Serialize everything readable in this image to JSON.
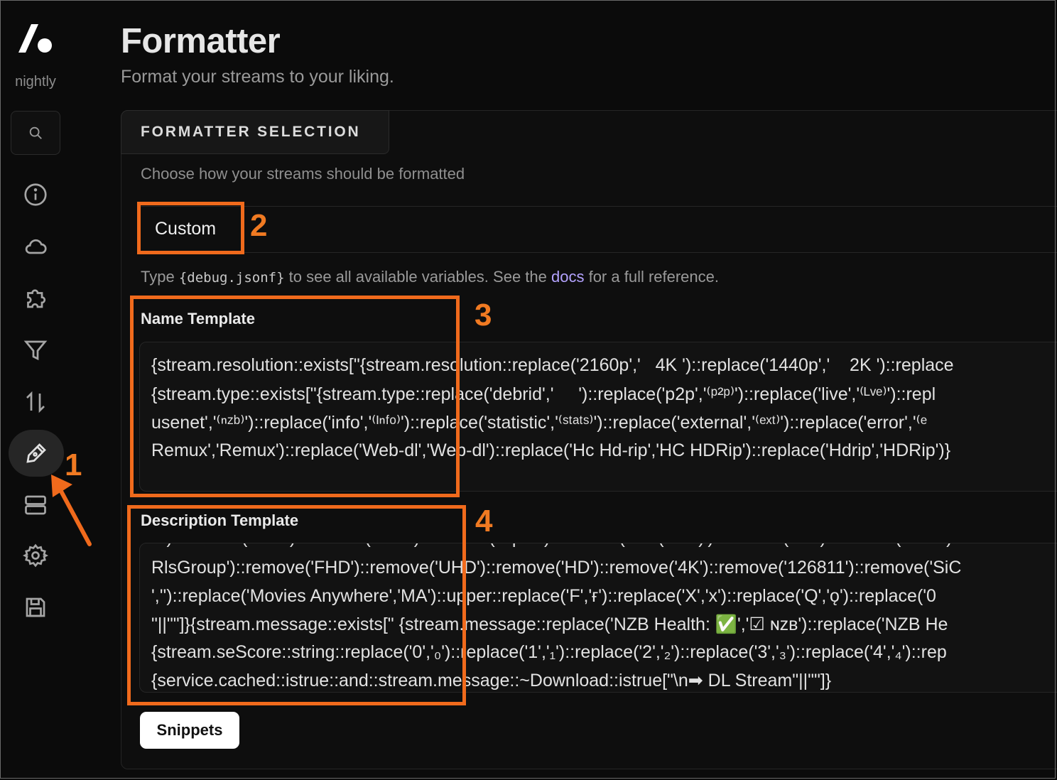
{
  "sidebar": {
    "brand_sub": "nightly",
    "icons": [
      "search-icon",
      "info-icon",
      "cloud-icon",
      "puzzle-icon",
      "filter-icon",
      "sort-icon",
      "pen-icon",
      "server-icon",
      "gear-icon",
      "save-icon"
    ],
    "active": "pen-icon"
  },
  "header": {
    "title": "Formatter",
    "subtitle": "Format your streams to your liking."
  },
  "section": {
    "tab": "FORMATTER SELECTION",
    "description": "Choose how your streams should be formatted",
    "selected": "Custom"
  },
  "help": {
    "prefix": "Type ",
    "code": "{debug.jsonf}",
    "middle": " to see all available variables. See the ",
    "link": "docs",
    "suffix": " for a full reference."
  },
  "name_template": {
    "label": "Name Template",
    "lines": [
      "{stream.resolution::exists[\"{stream.resolution::replace('2160p','   4K ')::replace('1440p','    2K ')::replace",
      "{stream.type::exists[\"{stream.type::replace('debrid','     ')::replace('p2p','⁽ᵖ²ᵖ⁾')::replace('live','⁽ᴸᵛᵉ⁾')::repl",
      "usenet','⁽ⁿᶻᵇ⁾')::replace('info','⁽ᴵⁿᶠᵒ⁾')::replace('statistic','⁽ˢᵗᵃᵗˢ⁾')::replace('external','⁽ᵉˣᵗ⁾')::replace('error','⁽ᵉ",
      "Remux','Remux')::replace('Web-dl','Web-dl')::replace('Hc Hd-rip','HC HDRip')::replace('Hdrip','HDRip')}"
    ]
  },
  "description_template": {
    "label": "Description Template",
    "lines": [
      "X')::remove('DTS')::remove('AAC')::remove('Opus')::remove('DV (Disk)')::remove('DV')::remove('HDR')",
      "RlsGroup')::remove('FHD')::remove('UHD')::remove('HD')::remove('4K')::remove('126811')::remove('SiC",
      "','')::replace('Movies Anywhere','MA')::upper::replace('F','ғ')::replace('X','x')::replace('Q','ǫ')::replace('0",
      "\"||\"\"]}{stream.message::exists[\" {stream.message::replace('NZB Health: ✅','☑ ɴᴢʙ')::replace('NZB He",
      "{stream.seScore::string::replace('0','₀')::replace('1','₁')::replace('2','₂')::replace('3','₃')::replace('4','₄')::rep",
      "{service.cached::istrue::and::stream.message::~Download::istrue[\"\\n➡ DL Stream\"||\"\"]}"
    ]
  },
  "snippets_button": "Snippets",
  "annotations": {
    "color": "#f06a1c",
    "labels": [
      "1",
      "2",
      "3",
      "4"
    ]
  }
}
